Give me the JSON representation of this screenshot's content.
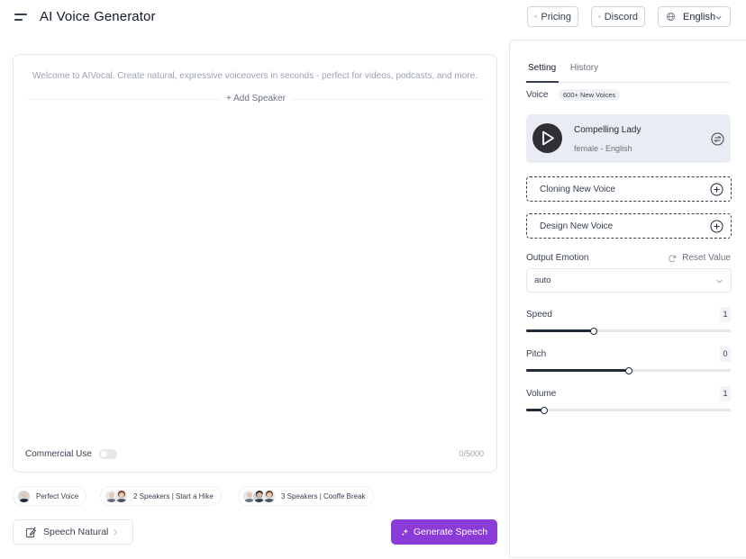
{
  "header": {
    "title": "AI Voice Generator",
    "pricing_label": "Pricing",
    "discord_label": "Discord",
    "language": "English"
  },
  "editor": {
    "placeholder": "Welcome to AIVocal. Create natural, expressive voiceovers in seconds - perfect for videos, podcasts, and more.",
    "add_speaker": "+ Add Speaker",
    "commercial_use_label": "Commercial Use",
    "commercial_use_enabled": false,
    "char_count": "0/5000"
  },
  "presets": [
    {
      "label": "Perfect Voice"
    },
    {
      "label": "2 Speakers | Start a Hike"
    },
    {
      "label": "3 Speakers | Cooffe Break"
    }
  ],
  "actions": {
    "speech_natural": "Speech Natural",
    "generate": "Generate Speech"
  },
  "panel": {
    "tabs": [
      {
        "label": "Setting",
        "active": true
      },
      {
        "label": "History",
        "active": false
      }
    ],
    "voice_label": "Voice",
    "voice_badge": "600+ New Voices",
    "selected_voice": {
      "name": "Compelling Lady",
      "meta": "female - English"
    },
    "cloning_label": "Cloning New Voice",
    "design_label": "Design New Voice",
    "emotion_label": "Output Emotion",
    "reset_label": "Reset Value",
    "emotion_value": "auto",
    "sliders": {
      "speed": {
        "label": "Speed",
        "value": "1",
        "fraction": 0.33
      },
      "pitch": {
        "label": "Pitch",
        "value": "0",
        "fraction": 0.5
      },
      "volume": {
        "label": "Volume",
        "value": "1",
        "fraction": 0.09
      }
    }
  },
  "colors": {
    "accent": "#8b3bd8",
    "dark": "#1f2937"
  },
  "icons": {
    "menu": "menu-icon",
    "pricing": "diamond-icon",
    "discord": "discord-icon",
    "language": "globe-icon",
    "play": "play-icon",
    "swap": "swap-icon",
    "add": "plus-circle-icon",
    "reset": "refresh-icon",
    "sparkle": "sparkle-icon",
    "natural": "edit-icon"
  }
}
